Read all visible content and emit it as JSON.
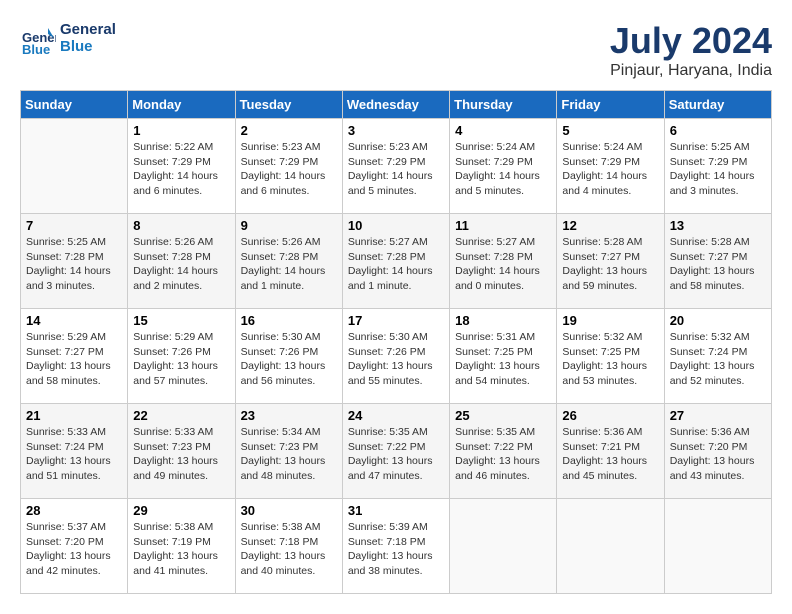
{
  "header": {
    "logo_line1": "General",
    "logo_line2": "Blue",
    "month_year": "July 2024",
    "location": "Pinjaur, Haryana, India"
  },
  "weekdays": [
    "Sunday",
    "Monday",
    "Tuesday",
    "Wednesday",
    "Thursday",
    "Friday",
    "Saturday"
  ],
  "weeks": [
    [
      {
        "day": "",
        "info": ""
      },
      {
        "day": "1",
        "info": "Sunrise: 5:22 AM\nSunset: 7:29 PM\nDaylight: 14 hours\nand 6 minutes."
      },
      {
        "day": "2",
        "info": "Sunrise: 5:23 AM\nSunset: 7:29 PM\nDaylight: 14 hours\nand 6 minutes."
      },
      {
        "day": "3",
        "info": "Sunrise: 5:23 AM\nSunset: 7:29 PM\nDaylight: 14 hours\nand 5 minutes."
      },
      {
        "day": "4",
        "info": "Sunrise: 5:24 AM\nSunset: 7:29 PM\nDaylight: 14 hours\nand 5 minutes."
      },
      {
        "day": "5",
        "info": "Sunrise: 5:24 AM\nSunset: 7:29 PM\nDaylight: 14 hours\nand 4 minutes."
      },
      {
        "day": "6",
        "info": "Sunrise: 5:25 AM\nSunset: 7:29 PM\nDaylight: 14 hours\nand 3 minutes."
      }
    ],
    [
      {
        "day": "7",
        "info": "Sunrise: 5:25 AM\nSunset: 7:28 PM\nDaylight: 14 hours\nand 3 minutes."
      },
      {
        "day": "8",
        "info": "Sunrise: 5:26 AM\nSunset: 7:28 PM\nDaylight: 14 hours\nand 2 minutes."
      },
      {
        "day": "9",
        "info": "Sunrise: 5:26 AM\nSunset: 7:28 PM\nDaylight: 14 hours\nand 1 minute."
      },
      {
        "day": "10",
        "info": "Sunrise: 5:27 AM\nSunset: 7:28 PM\nDaylight: 14 hours\nand 1 minute."
      },
      {
        "day": "11",
        "info": "Sunrise: 5:27 AM\nSunset: 7:28 PM\nDaylight: 14 hours\nand 0 minutes."
      },
      {
        "day": "12",
        "info": "Sunrise: 5:28 AM\nSunset: 7:27 PM\nDaylight: 13 hours\nand 59 minutes."
      },
      {
        "day": "13",
        "info": "Sunrise: 5:28 AM\nSunset: 7:27 PM\nDaylight: 13 hours\nand 58 minutes."
      }
    ],
    [
      {
        "day": "14",
        "info": "Sunrise: 5:29 AM\nSunset: 7:27 PM\nDaylight: 13 hours\nand 58 minutes."
      },
      {
        "day": "15",
        "info": "Sunrise: 5:29 AM\nSunset: 7:26 PM\nDaylight: 13 hours\nand 57 minutes."
      },
      {
        "day": "16",
        "info": "Sunrise: 5:30 AM\nSunset: 7:26 PM\nDaylight: 13 hours\nand 56 minutes."
      },
      {
        "day": "17",
        "info": "Sunrise: 5:30 AM\nSunset: 7:26 PM\nDaylight: 13 hours\nand 55 minutes."
      },
      {
        "day": "18",
        "info": "Sunrise: 5:31 AM\nSunset: 7:25 PM\nDaylight: 13 hours\nand 54 minutes."
      },
      {
        "day": "19",
        "info": "Sunrise: 5:32 AM\nSunset: 7:25 PM\nDaylight: 13 hours\nand 53 minutes."
      },
      {
        "day": "20",
        "info": "Sunrise: 5:32 AM\nSunset: 7:24 PM\nDaylight: 13 hours\nand 52 minutes."
      }
    ],
    [
      {
        "day": "21",
        "info": "Sunrise: 5:33 AM\nSunset: 7:24 PM\nDaylight: 13 hours\nand 51 minutes."
      },
      {
        "day": "22",
        "info": "Sunrise: 5:33 AM\nSunset: 7:23 PM\nDaylight: 13 hours\nand 49 minutes."
      },
      {
        "day": "23",
        "info": "Sunrise: 5:34 AM\nSunset: 7:23 PM\nDaylight: 13 hours\nand 48 minutes."
      },
      {
        "day": "24",
        "info": "Sunrise: 5:35 AM\nSunset: 7:22 PM\nDaylight: 13 hours\nand 47 minutes."
      },
      {
        "day": "25",
        "info": "Sunrise: 5:35 AM\nSunset: 7:22 PM\nDaylight: 13 hours\nand 46 minutes."
      },
      {
        "day": "26",
        "info": "Sunrise: 5:36 AM\nSunset: 7:21 PM\nDaylight: 13 hours\nand 45 minutes."
      },
      {
        "day": "27",
        "info": "Sunrise: 5:36 AM\nSunset: 7:20 PM\nDaylight: 13 hours\nand 43 minutes."
      }
    ],
    [
      {
        "day": "28",
        "info": "Sunrise: 5:37 AM\nSunset: 7:20 PM\nDaylight: 13 hours\nand 42 minutes."
      },
      {
        "day": "29",
        "info": "Sunrise: 5:38 AM\nSunset: 7:19 PM\nDaylight: 13 hours\nand 41 minutes."
      },
      {
        "day": "30",
        "info": "Sunrise: 5:38 AM\nSunset: 7:18 PM\nDaylight: 13 hours\nand 40 minutes."
      },
      {
        "day": "31",
        "info": "Sunrise: 5:39 AM\nSunset: 7:18 PM\nDaylight: 13 hours\nand 38 minutes."
      },
      {
        "day": "",
        "info": ""
      },
      {
        "day": "",
        "info": ""
      },
      {
        "day": "",
        "info": ""
      }
    ]
  ]
}
